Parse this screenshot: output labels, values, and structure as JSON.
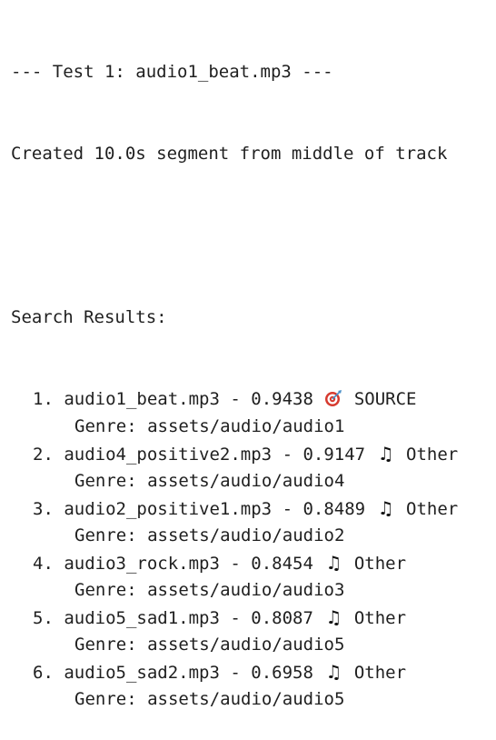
{
  "header": {
    "test_line": "--- Test 1: audio1_beat.mp3 ---",
    "segment_line": "Created 10.0s segment from middle of track"
  },
  "search": {
    "heading": "Search Results:"
  },
  "results": [
    {
      "index": "1.",
      "file": "audio1_beat.mp3",
      "sep": "-",
      "score": "0.9438",
      "icon": "target-icon",
      "tag": "SOURCE",
      "genre_label": "Genre:",
      "genre_path": "assets/audio/audio1"
    },
    {
      "index": "2.",
      "file": "audio4_positive2.mp3",
      "sep": "-",
      "score": "0.9147",
      "icon": "music-note-icon",
      "tag": "Other",
      "genre_label": "Genre:",
      "genre_path": "assets/audio/audio4"
    },
    {
      "index": "3.",
      "file": "audio2_positive1.mp3",
      "sep": "-",
      "score": "0.8489",
      "icon": "music-note-icon",
      "tag": "Other",
      "genre_label": "Genre:",
      "genre_path": "assets/audio/audio2"
    },
    {
      "index": "4.",
      "file": "audio3_rock.mp3",
      "sep": "-",
      "score": "0.8454",
      "icon": "music-note-icon",
      "tag": "Other",
      "genre_label": "Genre:",
      "genre_path": "assets/audio/audio3"
    },
    {
      "index": "5.",
      "file": "audio5_sad1.mp3",
      "sep": "-",
      "score": "0.8087",
      "icon": "music-note-icon",
      "tag": "Other",
      "genre_label": "Genre:",
      "genre_path": "assets/audio/audio5"
    },
    {
      "index": "6.",
      "file": "audio5_sad2.mp3",
      "sep": "-",
      "score": "0.6958",
      "icon": "music-note-icon",
      "tag": "Other",
      "genre_label": "Genre:",
      "genre_path": "assets/audio/audio5"
    }
  ],
  "colors": {
    "text": "#1f1f1f",
    "background": "#ffffff",
    "target_red": "#d63a2f",
    "target_dart": "#4a90c8"
  }
}
